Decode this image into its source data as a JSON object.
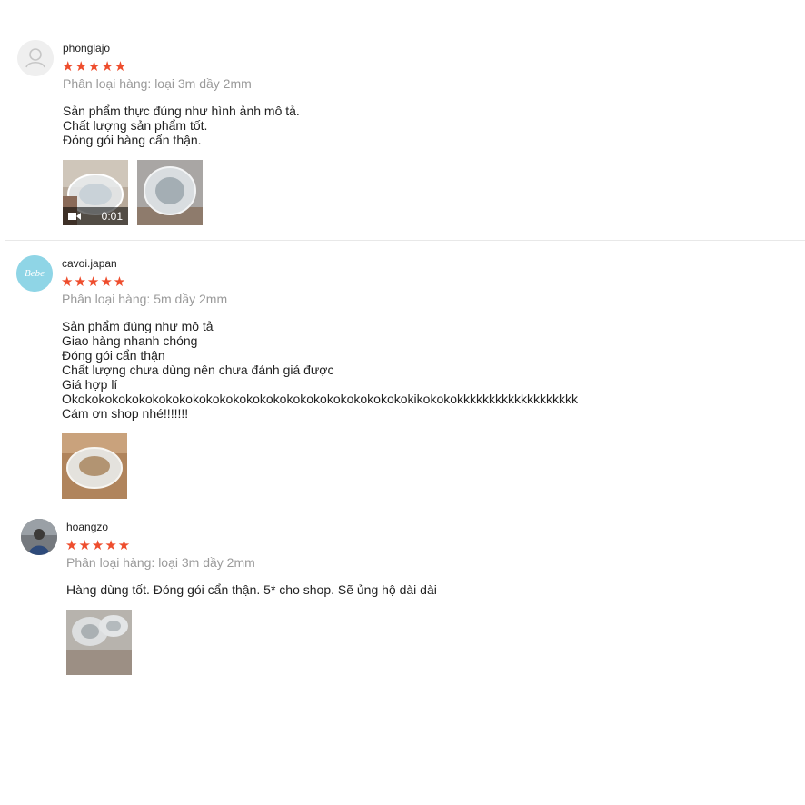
{
  "colors": {
    "star": "#ee4d2d",
    "variation_text": "#9a9a9a",
    "divider": "#e8e8e8"
  },
  "reviews": [
    {
      "username": "phonglajo",
      "rating": 5,
      "stars": "★★★★★",
      "variation": "Phân loại hàng: loại 3m dầy 2mm",
      "content": "Sản phẩm thực đúng như hình ảnh mô tả.\nChất lượng sản phẩm tốt.\nĐóng gói hàng cẩn thận.",
      "avatar_icon": "user-placeholder-icon",
      "media": [
        {
          "type": "video",
          "duration": "0:01",
          "icon": "video-camera-icon"
        },
        {
          "type": "image"
        }
      ]
    },
    {
      "username": "cavoi.japan",
      "rating": 5,
      "stars": "★★★★★",
      "variation": "Phân loại hàng: 5m dầy 2mm",
      "content": "Sản phẩm đúng như mô tả\nGiao hàng nhanh chóng\nĐóng gói cẩn thận\nChất lượng chưa dùng nên chưa đánh giá được\nGiá hợp lí\nOkokokokokokokokokokokokokokokokokokokokokokokokokokikokokokkkkkkkkkkkkkkkkkkk\nCám ơn shop nhé!!!!!!!",
      "avatar_logo": "Bebe",
      "media": [
        {
          "type": "image"
        }
      ]
    },
    {
      "username": "hoangzo",
      "rating": 5,
      "stars": "★★★★★",
      "variation": "Phân loại hàng: loại 3m dầy 2mm",
      "content": "Hàng dùng tốt. Đóng gói cẩn thận. 5* cho shop. Sẽ ủng hộ dài dài",
      "media": [
        {
          "type": "image"
        }
      ]
    }
  ]
}
